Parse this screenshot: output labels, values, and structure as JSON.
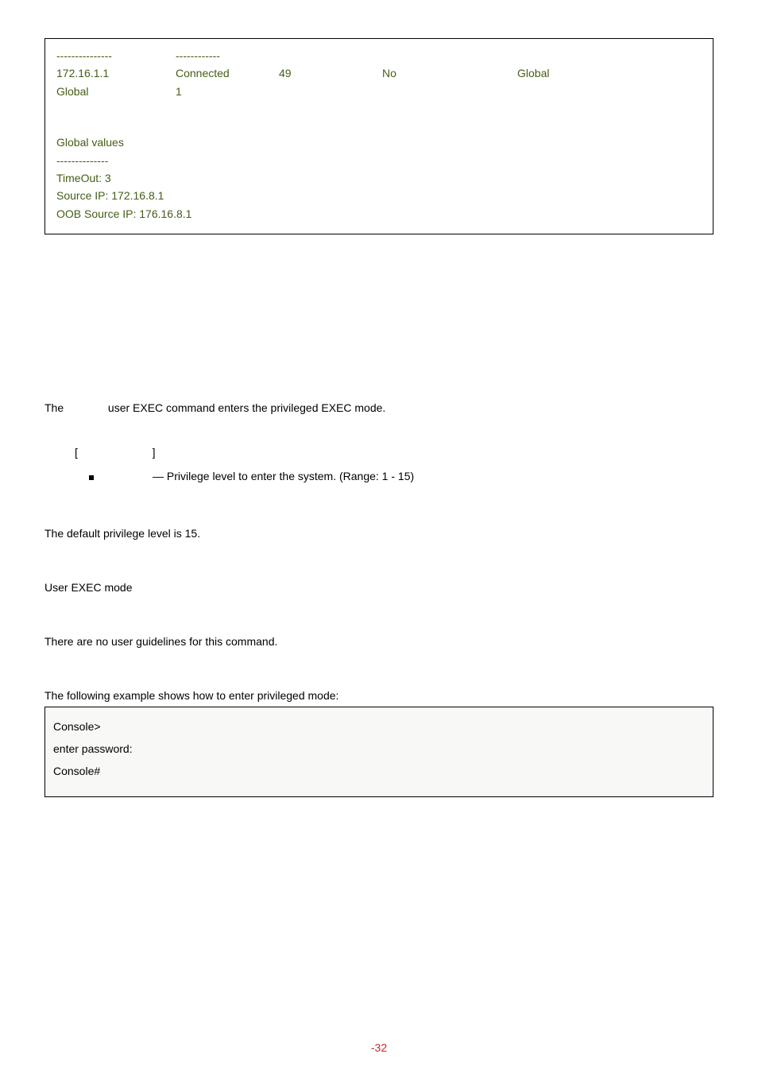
{
  "top_box": {
    "dash_row": {
      "c1": "---------------",
      "c2": "------------"
    },
    "row1": {
      "c1": "172.16.1.1",
      "c2": "Connected",
      "c3": "49",
      "c4": "No",
      "c5": "Global"
    },
    "row2": {
      "c1": "Global",
      "c2": "1"
    },
    "gv_header": "Global values",
    "gv_dashes": "--------------",
    "timeout": "TimeOut: 3",
    "src_ip": "Source IP: 172.16.8.1",
    "oob_ip": "OOB Source IP: 176.16.8.1"
  },
  "enable": {
    "desc_pre": "The",
    "desc_post": "user EXEC command enters the privileged EXEC mode.",
    "syntax_open": "[",
    "syntax_close": "]",
    "param_desc": "— Privilege level to enter the system. (Range: 1 - 15)",
    "default": "The default privilege level is 15.",
    "mode": "User EXEC mode",
    "guidelines": "There are no user guidelines for this command.",
    "example_intro": "The following example shows how to enter privileged mode:"
  },
  "example_box": {
    "l1": "Console>",
    "l2": "enter password:",
    "l3": "Console#"
  },
  "page_number": "-32"
}
